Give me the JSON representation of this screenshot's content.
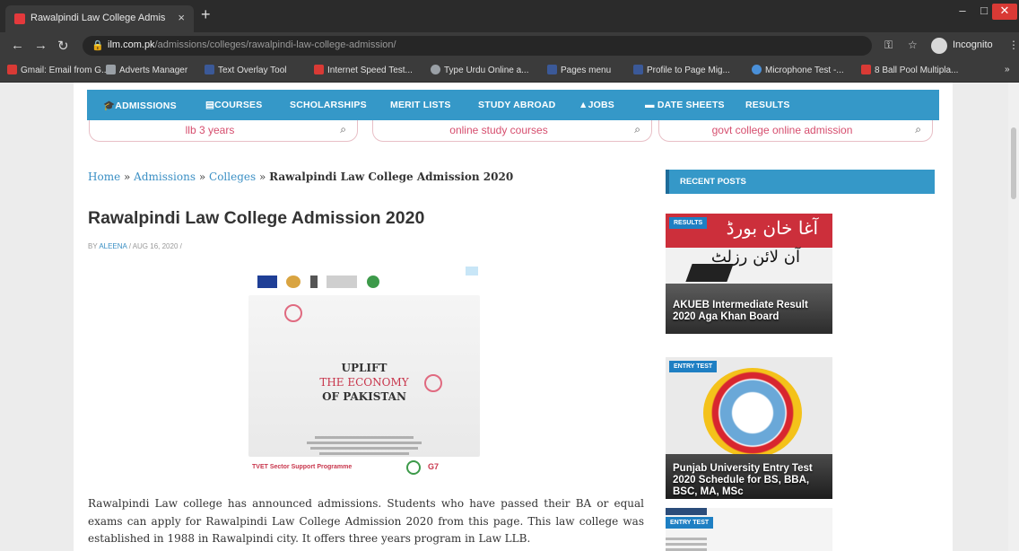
{
  "browser": {
    "tab_title": "Rawalpindi Law College Admiss",
    "tab_close": "×",
    "new_tab": "+",
    "url_host": "ilm.com.pk",
    "url_path": "/admissions/colleges/rawalpindi-law-college-admission/",
    "profile_label": "Incognito",
    "bookmarks": [
      {
        "label": "Gmail: Email from G...",
        "color": "#d93a35"
      },
      {
        "label": "Adverts Manager",
        "color": "#9aa0a6"
      },
      {
        "label": "Text Overlay Tool",
        "color": "#3b5998"
      },
      {
        "label": "Internet Speed Test...",
        "color": "#d93a35"
      },
      {
        "label": "Type Urdu Online a...",
        "color": "#9aa0a6"
      },
      {
        "label": "Pages menu",
        "color": "#3b5998"
      },
      {
        "label": "Profile to Page Mig...",
        "color": "#3b5998"
      },
      {
        "label": "Microphone Test -...",
        "color": "#4a90d9"
      },
      {
        "label": "8 Ball Pool Multipla...",
        "color": "#d93a35"
      }
    ],
    "bookmarks_more": "»"
  },
  "nav": {
    "items": [
      "ADMISSIONS",
      "COURSES",
      "SCHOLARSHIPS",
      "MERIT LISTS",
      "STUDY ABROAD",
      "JOBS",
      "DATE SHEETS",
      "RESULTS"
    ]
  },
  "search_pills": [
    "llb 3 years",
    "online study courses",
    "govt college online admission"
  ],
  "breadcrumb": {
    "home": "Home",
    "sep": "»",
    "admissions": "Admissions",
    "colleges": "Colleges",
    "current": "Rawalpindi Law College Admission 2020"
  },
  "post": {
    "title": "Rawalpindi Law College Admission 2020",
    "by": "BY",
    "author": "ALEENA",
    "date": "/ AUG 16, 2020 /",
    "intro": "Rawalpindi Law college has announced admissions. Students who have passed their BA or equal exams can apply for Rawalpindi Law College Admission 2020 from this page. This law college was established in 1988 in Rawalpindi city. It offers three years program in Law LLB."
  },
  "ad": {
    "line1": "UPLIFT",
    "line2": "THE ECONOMY",
    "line3": "OF PAKISTAN",
    "footer_left": "TVET Sector Support Programme",
    "footer_right": "G7"
  },
  "sidebar": {
    "header": "RECENT POSTS",
    "posts": [
      {
        "badge": "RESULTS",
        "urdu_top": "آغا خان بورڈ",
        "urdu_bottom": "آن لائن رزلٹ",
        "title": "AKUEB Intermediate Result 2020 Aga Khan Board"
      },
      {
        "badge": "ENTRY TEST",
        "title": "Punjab University Entry Test 2020 Schedule for BS, BBA, BSC, MA, MSc"
      },
      {
        "badge": "ENTRY TEST"
      }
    ]
  }
}
